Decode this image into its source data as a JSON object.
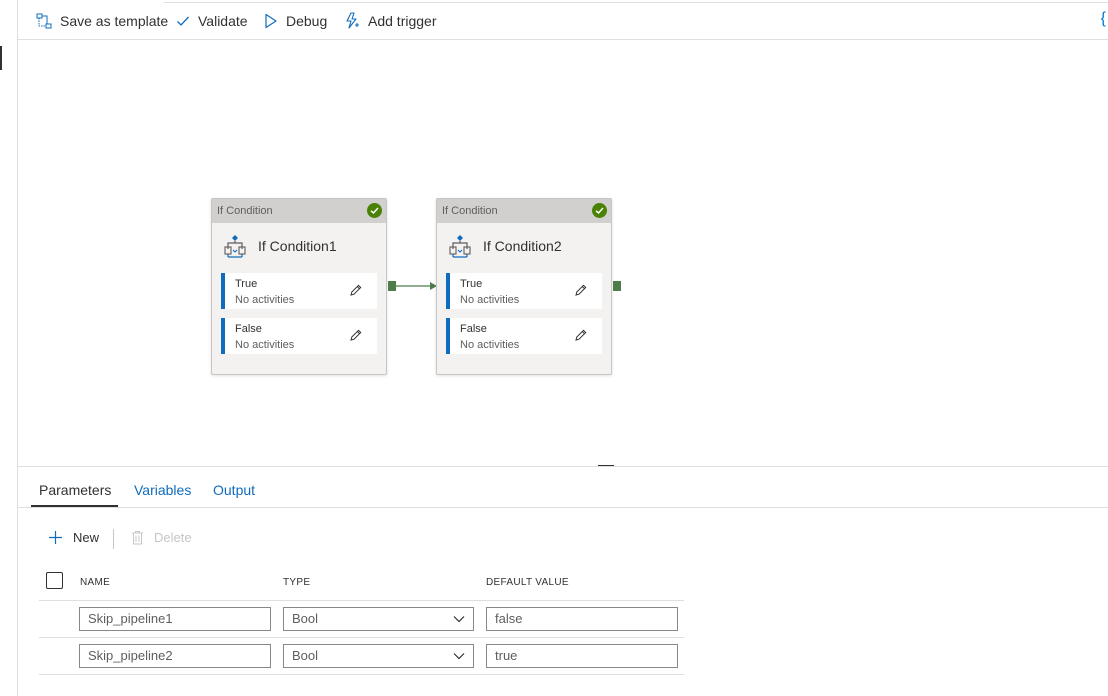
{
  "toolbar": {
    "save_template": "Save as template",
    "validate": "Validate",
    "debug": "Debug",
    "add_trigger": "Add trigger",
    "code_glyph": "{"
  },
  "activities": [
    {
      "header": "If Condition",
      "name": "If Condition1",
      "branches": [
        {
          "label": "True",
          "sub": "No activities"
        },
        {
          "label": "False",
          "sub": "No activities"
        }
      ]
    },
    {
      "header": "If Condition",
      "name": "If Condition2",
      "branches": [
        {
          "label": "True",
          "sub": "No activities"
        },
        {
          "label": "False",
          "sub": "No activities"
        }
      ]
    }
  ],
  "panel": {
    "tabs": [
      "Parameters",
      "Variables",
      "Output"
    ],
    "active_tab": "Parameters",
    "new_label": "New",
    "delete_label": "Delete",
    "columns": [
      "NAME",
      "TYPE",
      "DEFAULT VALUE"
    ],
    "rows": [
      {
        "name": "Skip_pipeline1",
        "type": "Bool",
        "default": "false"
      },
      {
        "name": "Skip_pipeline2",
        "type": "Bool",
        "default": "true"
      }
    ]
  },
  "colors": {
    "accent": "#0f6cbd",
    "success": "#498205",
    "port": "#4f7d4a"
  },
  "icons": {
    "save_template": "template-icon",
    "validate": "checkmark-icon",
    "debug": "play-icon",
    "add_trigger": "lightning-icon",
    "activity": "if-condition-icon",
    "status": "success-check-icon",
    "edit": "pencil-icon",
    "new": "plus-icon",
    "delete": "trash-icon",
    "dropdown": "chevron-down-icon"
  }
}
